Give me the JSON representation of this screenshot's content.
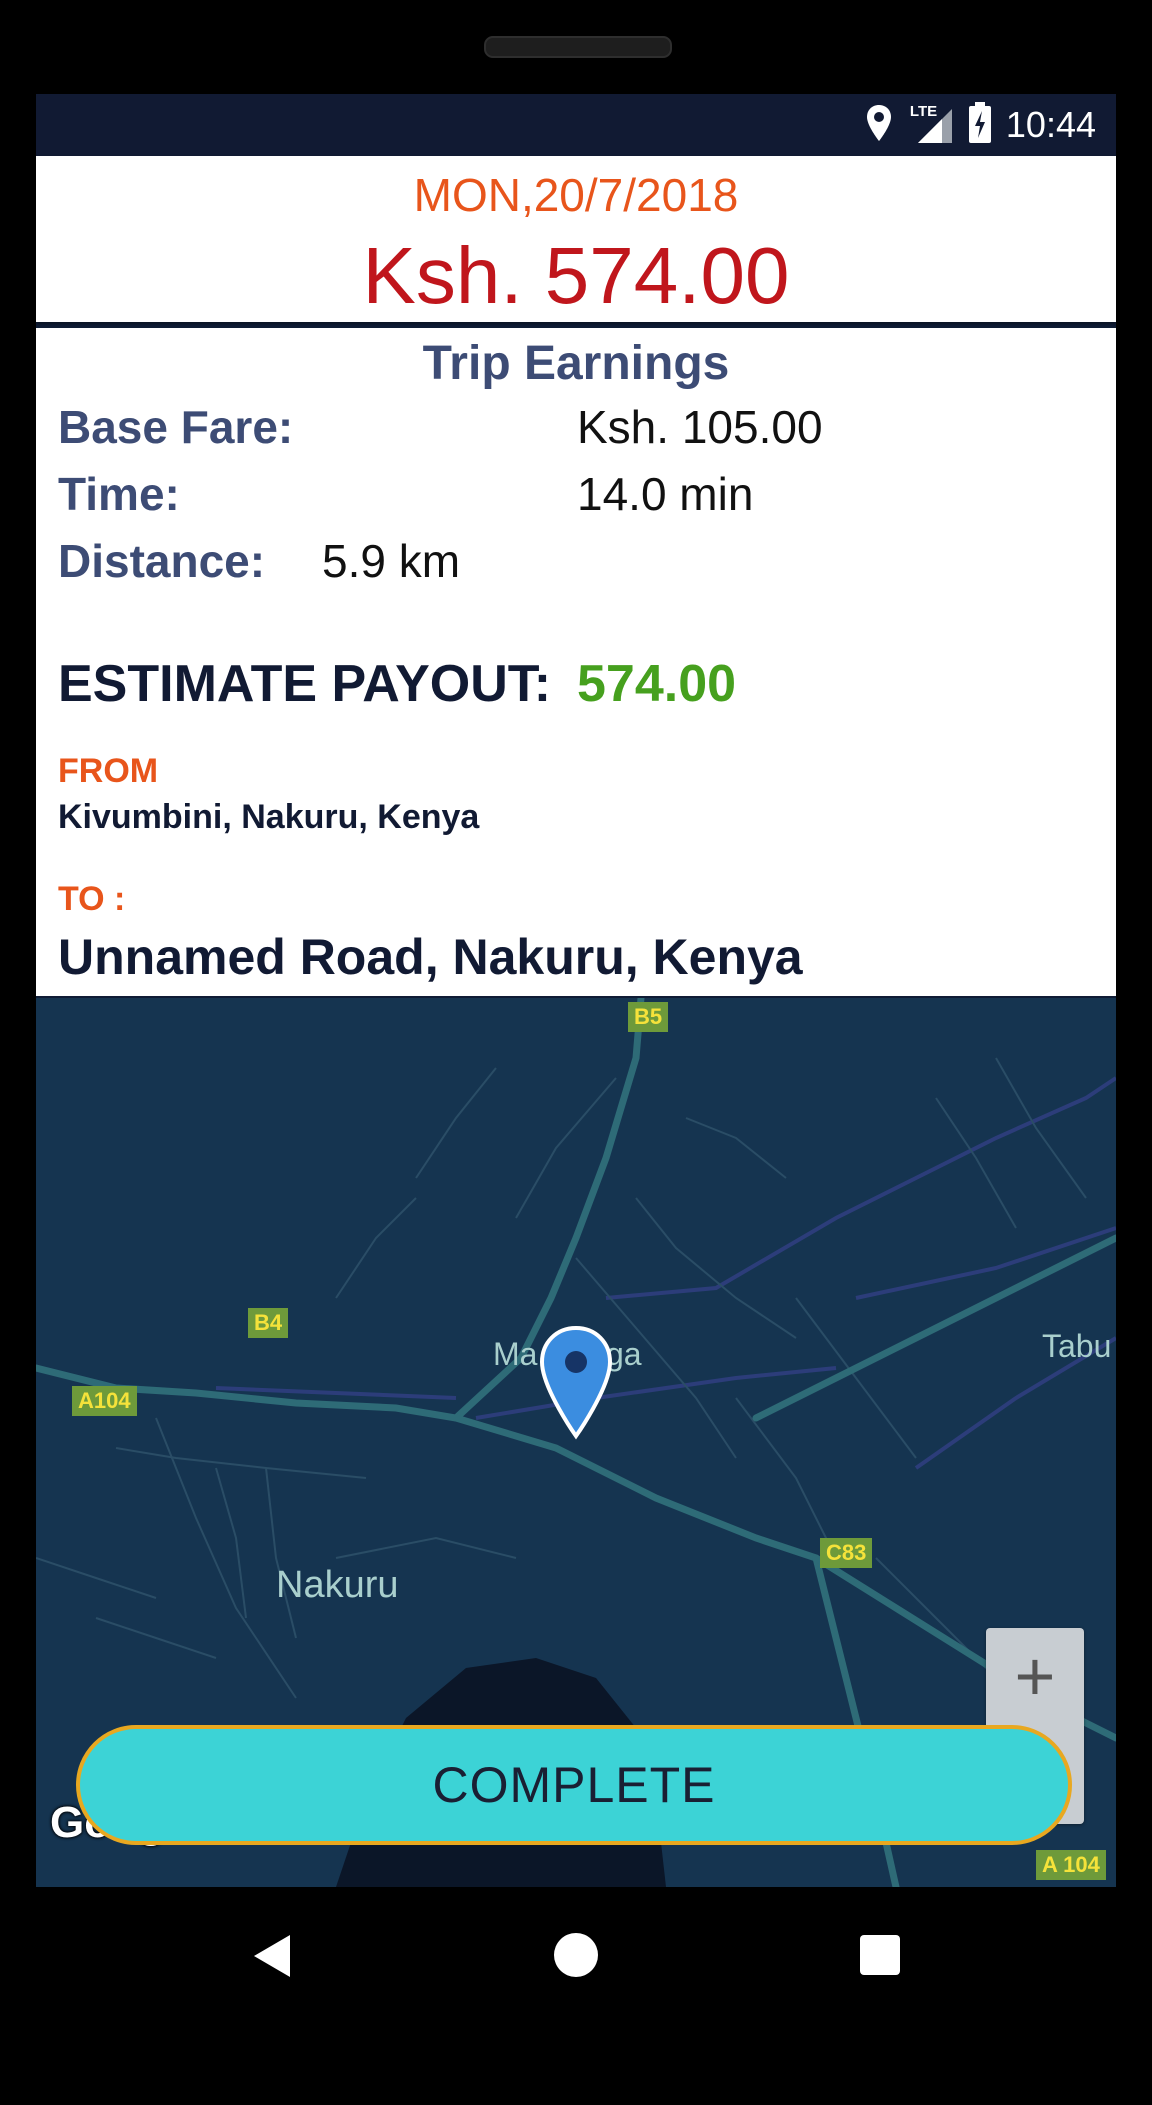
{
  "status_bar": {
    "time": "10:44",
    "network": "LTE",
    "icons": [
      "location-icon",
      "lte-signal-icon",
      "battery-charging-icon"
    ]
  },
  "header": {
    "date": "MON,20/7/2018",
    "total": "Ksh. 574.00"
  },
  "trip": {
    "title": "Trip Earnings",
    "base_fare_label": "Base Fare:",
    "base_fare_value": "Ksh. 105.00",
    "time_label": "Time:",
    "time_value": "14.0 min",
    "distance_label": "Distance:",
    "distance_value": "5.9 km",
    "payout_label": "ESTIMATE PAYOUT:",
    "payout_value": "574.00",
    "from_label": "FROM",
    "from_address": "Kivumbini, Nakuru, Kenya",
    "to_label": "TO :",
    "to_address": "Unnamed Road, Nakuru, Kenya"
  },
  "map": {
    "labels": {
      "b5": "B5",
      "b4": "B4",
      "a104": "A104",
      "c83": "C83",
      "a104_bottom": "A 104",
      "place_nakuru": "Nakuru",
      "place_tabu": "Tabu",
      "place_mawanga_start": "Ma",
      "place_mawanga_end": "ga"
    },
    "zoom_in_label": "+",
    "attribution": "Google",
    "colors": {
      "land": "#153450",
      "road": "#2e6b77",
      "boundary": "#2c3d7a",
      "lake": "#0b1628"
    }
  },
  "actions": {
    "complete_label": "COMPLETE"
  },
  "colors": {
    "accent_orange": "#e8551b",
    "total_red": "#c0161c",
    "payout_green": "#46a01e",
    "label_blue": "#3d4c75",
    "button_cyan": "#3cd3d6",
    "button_border": "#e8a820"
  }
}
